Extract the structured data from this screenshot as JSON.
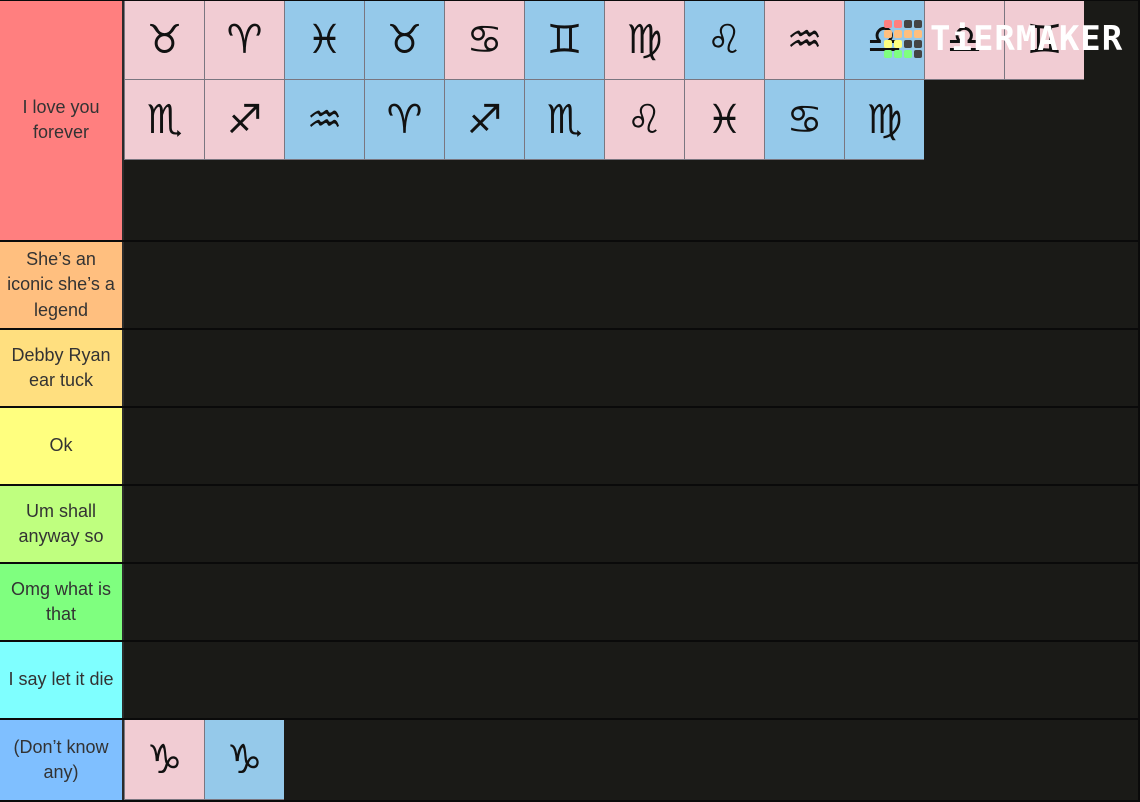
{
  "logo": {
    "text": "TiERMAKER",
    "grid_colors": [
      "#ff7f7f",
      "#ff7f7f",
      "#444444",
      "#444444",
      "#ffbf7f",
      "#ffbf7f",
      "#ffbf7f",
      "#ffbf7f",
      "#ffff7f",
      "#ffff7f",
      "#444444",
      "#444444",
      "#7fff7f",
      "#7fff7f",
      "#7fff7f",
      "#444444"
    ]
  },
  "colors": {
    "tile_pink": "#f1ccd3",
    "tile_blue": "#95c9ea",
    "background": "#1a1a17"
  },
  "tiers": [
    {
      "label": "I love you forever",
      "color": "#ff7f7f",
      "items": [
        {
          "symbol": "♉",
          "name": "taurus",
          "color": "pink"
        },
        {
          "symbol": "♈",
          "name": "aries",
          "color": "pink"
        },
        {
          "symbol": "♓",
          "name": "pisces",
          "color": "blue"
        },
        {
          "symbol": "♉",
          "name": "taurus",
          "color": "blue"
        },
        {
          "symbol": "♋",
          "name": "cancer",
          "color": "pink"
        },
        {
          "symbol": "♊",
          "name": "gemini",
          "color": "blue"
        },
        {
          "symbol": "♍",
          "name": "virgo",
          "color": "pink"
        },
        {
          "symbol": "♌",
          "name": "leo",
          "color": "blue"
        },
        {
          "symbol": "♒",
          "name": "aquarius",
          "color": "pink"
        },
        {
          "symbol": "♎",
          "name": "libra",
          "color": "blue"
        },
        {
          "symbol": "♎",
          "name": "libra",
          "color": "pink"
        },
        {
          "symbol": "♊",
          "name": "gemini",
          "color": "pink"
        },
        {
          "symbol": "♏",
          "name": "scorpio",
          "color": "pink"
        },
        {
          "symbol": "♐",
          "name": "sagittarius",
          "color": "pink"
        },
        {
          "symbol": "♒",
          "name": "aquarius",
          "color": "blue"
        },
        {
          "symbol": "♈",
          "name": "aries",
          "color": "blue"
        },
        {
          "symbol": "♐",
          "name": "sagittarius",
          "color": "blue"
        },
        {
          "symbol": "♏",
          "name": "scorpio",
          "color": "blue"
        },
        {
          "symbol": "♌",
          "name": "leo",
          "color": "pink"
        },
        {
          "symbol": "♓",
          "name": "pisces",
          "color": "pink"
        },
        {
          "symbol": "♋",
          "name": "cancer",
          "color": "blue"
        },
        {
          "symbol": "♍",
          "name": "virgo",
          "color": "blue"
        }
      ]
    },
    {
      "label": "She’s an iconic she’s a legend",
      "color": "#ffbf7f",
      "items": []
    },
    {
      "label": "Debby Ryan ear tuck",
      "color": "#ffdf7f",
      "items": []
    },
    {
      "label": "Ok",
      "color": "#ffff7f",
      "items": []
    },
    {
      "label": "Um shall anyway so",
      "color": "#bfff7f",
      "items": []
    },
    {
      "label": "Omg what is that",
      "color": "#7fff7f",
      "items": []
    },
    {
      "label": "I say let it die",
      "color": "#7fffff",
      "items": []
    },
    {
      "label": "(Don’t know any)",
      "color": "#7fbfff",
      "items": [
        {
          "symbol": "♑",
          "name": "capricorn",
          "color": "pink"
        },
        {
          "symbol": "♑",
          "name": "capricorn",
          "color": "blue"
        }
      ]
    }
  ]
}
